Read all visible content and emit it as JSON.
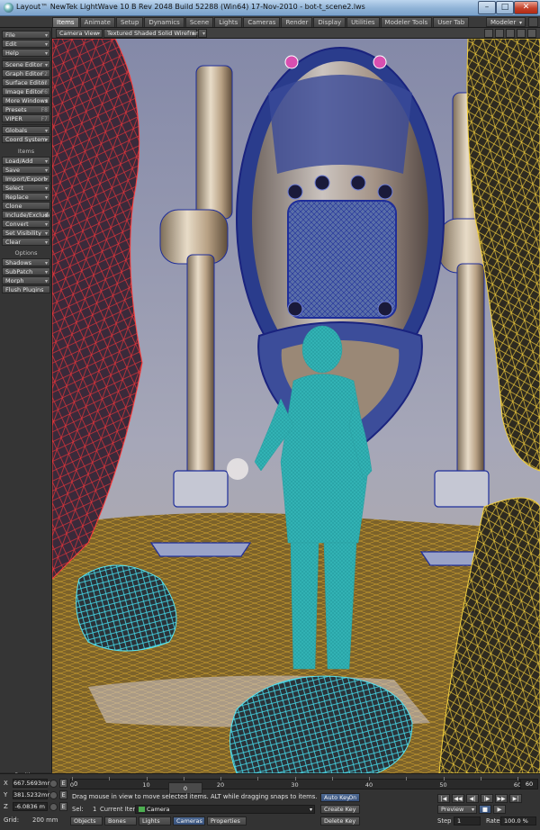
{
  "titlebar": {
    "title": "Layout™ NewTek LightWave 10 B   Rev 2048 Build 52288 (Win64) 17-Nov-2010   -  bot-t_scene2.lws",
    "controls": [
      "minimize",
      "maximize",
      "close"
    ]
  },
  "tabs": [
    "Items",
    "Animate",
    "Setup",
    "Dynamics",
    "Scene",
    "Lights",
    "Cameras",
    "Render",
    "Display",
    "Utilities",
    "Modeler Tools",
    "User Tab"
  ],
  "active_tab": "Items",
  "modeler_label": "Modeler",
  "sidebar": {
    "top": [
      "File",
      "Edit",
      "Help"
    ],
    "editors": [
      {
        "label": "Scene Editor",
        "arrow": true
      },
      {
        "label": "Graph Editor",
        "hotkey": "F2"
      },
      {
        "label": "Surface Editor",
        "hotkey": "F5"
      },
      {
        "label": "Image Editor",
        "hotkey": "F6"
      },
      {
        "label": "More Windows",
        "arrow": true
      },
      {
        "label": "Presets",
        "hotkey": "F8"
      },
      {
        "label": "VIPER",
        "hotkey": "F7"
      }
    ],
    "globals": [
      "Globals",
      "Coord System"
    ],
    "items_heading": "Items",
    "items": [
      "Load/Add",
      "Save",
      "Import/Export",
      "Select",
      "Replace",
      "Clone",
      "Include/Exclude",
      "Convert",
      "Set Visibility",
      "Clear"
    ],
    "options_heading": "Options",
    "options": [
      "Shadows",
      "SubPatch",
      "Morph",
      "Flush Plugins"
    ],
    "position_label": "Position"
  },
  "viewport": {
    "view_mode": "Camera View",
    "shading_mode": "Textured Shaded Solid Wireframe"
  },
  "coords": {
    "x_label": "X",
    "x_value": "667.5693mm",
    "y_label": "Y",
    "y_value": "381.5232mm",
    "z_label": "Z",
    "z_value": "-6.0836 m",
    "grid_label": "Grid:",
    "grid_value": "200 mm"
  },
  "timeline": {
    "start": "0",
    "current": "0",
    "ticks": [
      "0",
      "10",
      "20",
      "30",
      "40",
      "50",
      "60"
    ],
    "end": "60"
  },
  "status": {
    "message": "Drag mouse in view to move selected items. ALT while dragging snaps to items.",
    "sel_label": "Sel:",
    "sel_count": "1",
    "current_item_label": "Current Item",
    "current_item_value": "Camera"
  },
  "item_types": [
    "Objects",
    "Bones",
    "Lights",
    "Cameras",
    "Properties"
  ],
  "active_item_type": "Cameras",
  "keys": {
    "auto_key": "Auto Key",
    "auto_key_state": "On",
    "create_key": "Create Key",
    "delete_key": "Delete Key"
  },
  "playback": {
    "mode": "Preview",
    "step_label": "Step",
    "step_value": "1",
    "rate_label": "Rate",
    "rate_value": "100.0 %",
    "transport": [
      "|◀",
      "◀◀",
      "◀|",
      "|▶",
      "▶▶",
      "▶|"
    ]
  }
}
